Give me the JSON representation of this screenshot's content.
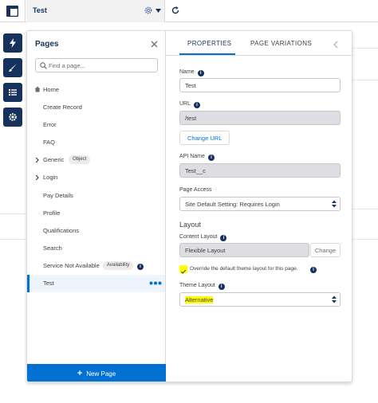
{
  "colors": {
    "navy": "#16325c",
    "brand_blue": "#0070d2",
    "border": "#dddbda",
    "highlight": "#ffff00",
    "disabled_field": "#dcdee3"
  },
  "topbar": {
    "current_page": "Test",
    "icons": [
      "app-layout-icon",
      "gear-icon",
      "chevron-down-icon",
      "refresh-icon"
    ]
  },
  "rail": {
    "icons": [
      "lightning-icon",
      "brush-icon",
      "list-icon",
      "settings-gear-icon"
    ]
  },
  "pages_panel": {
    "title": "Pages",
    "search_placeholder": "Find a page...",
    "items": [
      {
        "label": "Home",
        "icon": "home-icon"
      },
      {
        "label": "Create Record"
      },
      {
        "label": "Error"
      },
      {
        "label": "FAQ"
      },
      {
        "label": "Generic",
        "badge": "Object",
        "expandable": true
      },
      {
        "label": "Login",
        "expandable": true
      },
      {
        "label": "Pay Details"
      },
      {
        "label": "Profile"
      },
      {
        "label": "Qualifications"
      },
      {
        "label": "Search"
      },
      {
        "label": "Service Not Available",
        "badge": "Availability",
        "info": true
      },
      {
        "label": "Test",
        "selected": true
      }
    ],
    "new_page_label": "New Page"
  },
  "properties": {
    "tabs": [
      "PROPERTIES",
      "PAGE VARIATIONS"
    ],
    "active_tab": "PROPERTIES",
    "name_label": "Name",
    "name_value": "Test",
    "url_label": "URL",
    "url_value": "/test",
    "change_url_label": "Change URL",
    "api_name_label": "API Name",
    "api_name_value": "Test__c",
    "page_access_label": "Page Access",
    "page_access_value": "Site Default Setting: Requires Login",
    "layout_title": "Layout",
    "content_layout_label": "Content Layout",
    "content_layout_value": "Flexible Layout",
    "change_label": "Change",
    "override_label": "Override the default theme layout for this page.",
    "override_checked": true,
    "theme_layout_label": "Theme Layout",
    "theme_layout_value": "Alternative"
  }
}
